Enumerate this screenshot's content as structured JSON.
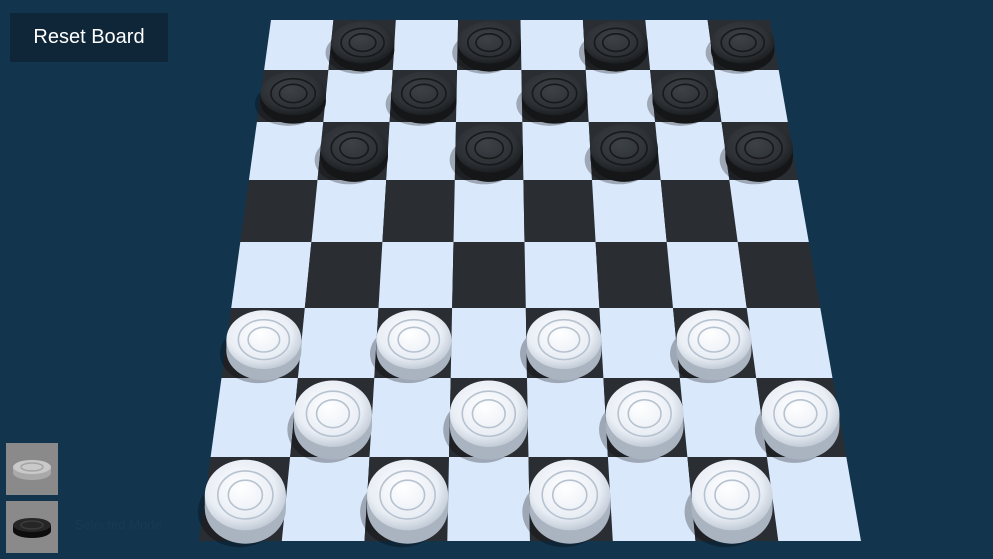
{
  "toolbar": {
    "reset_label": "Reset Board"
  },
  "board": {
    "rows": 8,
    "cols": 8,
    "colors": {
      "light_square": "#dae8fb",
      "dark_square": "#2a2d32",
      "white_piece": "#f2f5fa",
      "black_piece": "#2f3337",
      "background": "#12344d"
    },
    "pieces": [
      {
        "row": 0,
        "col": 1,
        "color": "black"
      },
      {
        "row": 0,
        "col": 3,
        "color": "black"
      },
      {
        "row": 0,
        "col": 5,
        "color": "black"
      },
      {
        "row": 0,
        "col": 7,
        "color": "black"
      },
      {
        "row": 1,
        "col": 0,
        "color": "black"
      },
      {
        "row": 1,
        "col": 2,
        "color": "black"
      },
      {
        "row": 1,
        "col": 4,
        "color": "black"
      },
      {
        "row": 1,
        "col": 6,
        "color": "black"
      },
      {
        "row": 2,
        "col": 1,
        "color": "black"
      },
      {
        "row": 2,
        "col": 3,
        "color": "black"
      },
      {
        "row": 2,
        "col": 5,
        "color": "black"
      },
      {
        "row": 2,
        "col": 7,
        "color": "black"
      },
      {
        "row": 5,
        "col": 0,
        "color": "white"
      },
      {
        "row": 5,
        "col": 2,
        "color": "white"
      },
      {
        "row": 5,
        "col": 4,
        "color": "white"
      },
      {
        "row": 5,
        "col": 6,
        "color": "white"
      },
      {
        "row": 6,
        "col": 1,
        "color": "white"
      },
      {
        "row": 6,
        "col": 3,
        "color": "white"
      },
      {
        "row": 6,
        "col": 5,
        "color": "white"
      },
      {
        "row": 6,
        "col": 7,
        "color": "white"
      },
      {
        "row": 7,
        "col": 0,
        "color": "white"
      },
      {
        "row": 7,
        "col": 2,
        "color": "white"
      },
      {
        "row": 7,
        "col": 4,
        "color": "white"
      },
      {
        "row": 7,
        "col": 6,
        "color": "white"
      }
    ]
  },
  "side_controls": {
    "white_piece_icon": "white-checker-icon",
    "black_piece_icon": "black-checker-icon",
    "mode_label": "Selected Mode"
  }
}
